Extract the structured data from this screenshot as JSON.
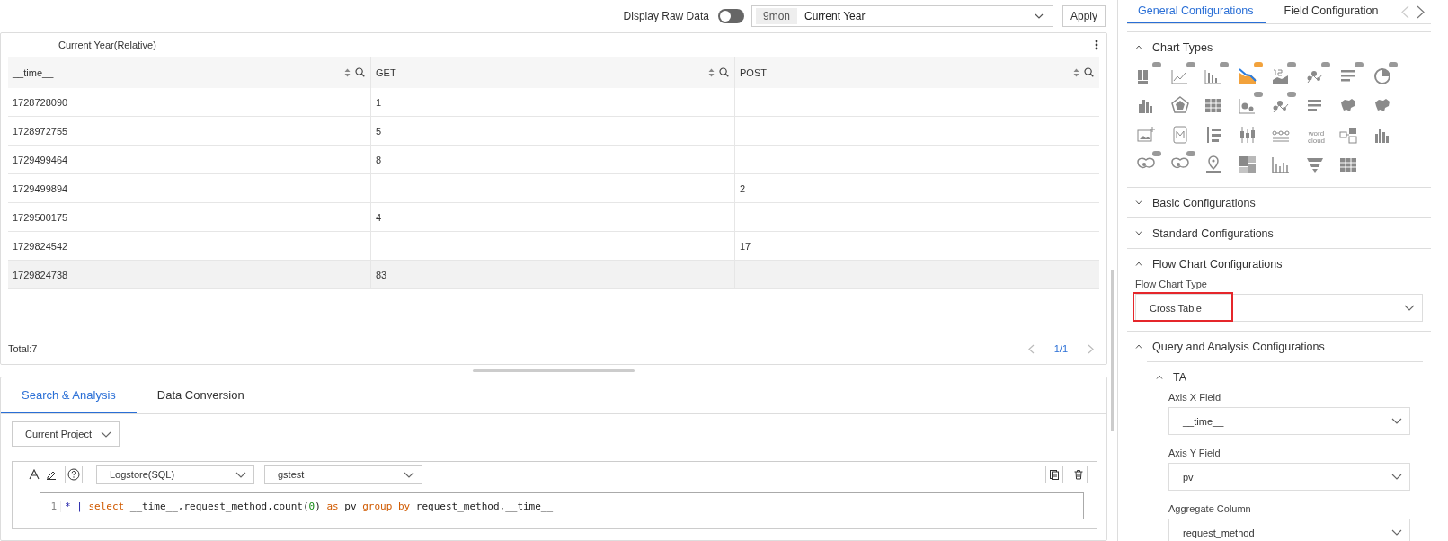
{
  "toolbar": {
    "raw_label": "Display Raw Data",
    "raw_on": false,
    "time_chip": "9mon",
    "time_value": "Current Year",
    "apply": "Apply"
  },
  "result": {
    "title": "Current Year(Relative)",
    "columns": [
      "__time__",
      "GET",
      "POST"
    ],
    "rows": [
      {
        "cells": [
          "1728728090",
          "1",
          null
        ],
        "selected": false
      },
      {
        "cells": [
          "1728972755",
          "5",
          null
        ],
        "selected": false
      },
      {
        "cells": [
          "1729499464",
          "8",
          null
        ],
        "selected": false
      },
      {
        "cells": [
          "1729499894",
          null,
          "2"
        ],
        "selected": false
      },
      {
        "cells": [
          "1729500175",
          "4",
          null
        ],
        "selected": false
      },
      {
        "cells": [
          "1729824542",
          null,
          "17"
        ],
        "selected": false
      },
      {
        "cells": [
          "1729824738",
          "83",
          null
        ],
        "selected": true
      }
    ],
    "total": "Total:7",
    "page": "1/1"
  },
  "query_panel": {
    "tabs": [
      {
        "label": "Search & Analysis",
        "selected": true
      },
      {
        "label": "Data Conversion",
        "selected": false
      }
    ],
    "project": "Current Project",
    "store_type": "Logstore(SQL)",
    "store": "gstest",
    "line_number": "1",
    "code": [
      {
        "text": "*",
        "kind": "operator"
      },
      {
        "text": " | ",
        "kind": "operator"
      },
      {
        "text": "select",
        "kind": "keyword"
      },
      {
        "text": " __time__,request_method,count(",
        "kind": "plain"
      },
      {
        "text": "0",
        "kind": "number"
      },
      {
        "text": ") ",
        "kind": "plain"
      },
      {
        "text": "as",
        "kind": "keyword"
      },
      {
        "text": " pv ",
        "kind": "plain"
      },
      {
        "text": "group by",
        "kind": "keyword"
      },
      {
        "text": " request_method,__time__",
        "kind": "plain"
      }
    ]
  },
  "settings": {
    "tabs": [
      {
        "label": "General Configurations",
        "selected": true
      },
      {
        "label": "Field Configuration",
        "selected": false
      }
    ],
    "sections": [
      {
        "title": "Chart Types",
        "expanded": true,
        "kind": "chart_types",
        "chart_types": [
          {
            "kind": "grid",
            "pro": true,
            "selected": false
          },
          {
            "kind": "line",
            "pro": true,
            "selected": false
          },
          {
            "kind": "bar",
            "pro": true,
            "selected": false
          },
          {
            "kind": "area",
            "pro": true,
            "selected": true
          },
          {
            "kind": "number",
            "pro": true,
            "selected": false
          },
          {
            "kind": "scatter-line",
            "pro": true,
            "selected": false
          },
          {
            "kind": "list",
            "pro": true,
            "selected": false
          },
          {
            "kind": "pie",
            "pro": true,
            "selected": false
          },
          {
            "kind": "histogram",
            "pro": false,
            "selected": false
          },
          {
            "kind": "radar",
            "pro": false,
            "selected": false
          },
          {
            "kind": "table",
            "pro": false,
            "selected": false
          },
          {
            "kind": "bubble",
            "pro": true,
            "selected": false
          },
          {
            "kind": "scatter",
            "pro": true,
            "selected": false
          },
          {
            "kind": "rows",
            "pro": false,
            "selected": false
          },
          {
            "kind": "map",
            "pro": false,
            "selected": false
          },
          {
            "kind": "world-map",
            "pro": false,
            "selected": false
          },
          {
            "kind": "image",
            "pro": false,
            "selected": false
          },
          {
            "kind": "markdown",
            "pro": false,
            "selected": false
          },
          {
            "kind": "timeline",
            "pro": false,
            "selected": false
          },
          {
            "kind": "candlestick",
            "pro": false,
            "selected": false
          },
          {
            "kind": "flow",
            "pro": false,
            "selected": false
          },
          {
            "kind": "wordcloud",
            "label": "word cloud",
            "pro": false,
            "selected": false
          },
          {
            "kind": "topology",
            "pro": false,
            "selected": false
          },
          {
            "kind": "column",
            "pro": false,
            "selected": false
          },
          {
            "kind": "map-book",
            "pro": true,
            "selected": false
          },
          {
            "kind": "cloud-map",
            "pro": true,
            "selected": false
          },
          {
            "kind": "pin",
            "pro": false,
            "selected": false
          },
          {
            "kind": "treemap",
            "pro": false,
            "selected": false
          },
          {
            "kind": "histogram-axis",
            "pro": false,
            "selected": false
          },
          {
            "kind": "funnel",
            "pro": false,
            "selected": false
          },
          {
            "kind": "table",
            "pro": false,
            "selected": false
          }
        ]
      },
      {
        "title": "Basic Configurations",
        "expanded": false
      },
      {
        "title": "Standard Configurations",
        "expanded": false
      },
      {
        "title": "Flow Chart Configurations",
        "expanded": true,
        "kind": "fields",
        "fields": [
          {
            "label": "Flow Chart Type",
            "value": "Cross Table",
            "highlighted": true
          }
        ]
      },
      {
        "title": "Query and Analysis Configurations",
        "expanded": true,
        "kind": "groups",
        "groups": [
          {
            "title": "TA",
            "expanded": true,
            "fields": [
              {
                "label": "Axis X Field",
                "value": "__time__",
                "highlighted": false
              },
              {
                "label": "Axis Y Field",
                "value": "pv",
                "highlighted": false
              },
              {
                "label": "Aggregate Column",
                "value": "request_method",
                "highlighted": false
              }
            ]
          }
        ]
      }
    ]
  }
}
